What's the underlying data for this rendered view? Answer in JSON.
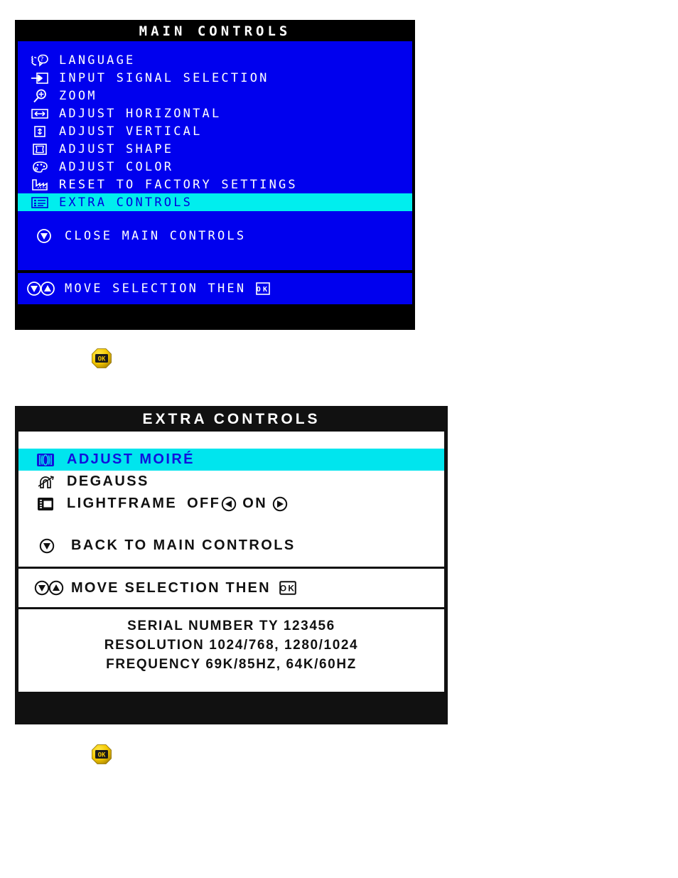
{
  "main_controls": {
    "title": "MAIN CONTROLS",
    "colors": {
      "background": "#0000ee",
      "header": "#000000",
      "text": "#ffffff",
      "highlight": "#00eeee",
      "highlight_text": "#0000dd"
    },
    "items": [
      {
        "icon": "language-head-question-icon",
        "label": "LANGUAGE",
        "selected": false
      },
      {
        "icon": "input-signal-arrow-icon",
        "label": "INPUT SIGNAL SELECTION",
        "selected": false
      },
      {
        "icon": "zoom-magnifier-icon",
        "label": "ZOOM",
        "selected": false
      },
      {
        "icon": "adjust-horizontal-icon",
        "label": "ADJUST HORIZONTAL",
        "selected": false
      },
      {
        "icon": "adjust-vertical-icon",
        "label": "ADJUST VERTICAL",
        "selected": false
      },
      {
        "icon": "adjust-shape-icon",
        "label": "ADJUST SHAPE",
        "selected": false
      },
      {
        "icon": "adjust-color-palette-icon",
        "label": "ADJUST COLOR",
        "selected": false
      },
      {
        "icon": "factory-reset-icon",
        "label": "RESET TO FACTORY SETTINGS",
        "selected": false
      },
      {
        "icon": "extra-controls-list-icon",
        "label": "EXTRA CONTROLS",
        "selected": true
      }
    ],
    "close_item": {
      "icon": "down-arrow-circle-icon",
      "label": "CLOSE MAIN CONTROLS"
    },
    "footer": {
      "icons": "down-up-arrow-circle-icons",
      "label": "MOVE SELECTION THEN",
      "ok_icon": "ok-key-icon"
    }
  },
  "ok_button_1": {
    "label": "OK",
    "name": "ok-button-icon"
  },
  "ok_button_2": {
    "label": "OK",
    "name": "ok-button-icon"
  },
  "extra_controls": {
    "title": "EXTRA CONTROLS",
    "colors": {
      "background": "#ffffff",
      "header": "#111111",
      "text": "#111111",
      "highlight": "#00e5ee",
      "highlight_text": "#1111dd"
    },
    "items": [
      {
        "icon": "adjust-moire-icon",
        "label": "ADJUST MOIRÉ",
        "selected": true
      },
      {
        "icon": "degauss-magnet-icon",
        "label": "DEGAUSS",
        "selected": false
      }
    ],
    "lightframe": {
      "icon": "lightframe-monitor-icon",
      "label": "LIGHTFRAME",
      "off_label": "OFF",
      "off_icon": "left-arrow-circle-icon",
      "on_label": "ON",
      "on_icon": "right-arrow-circle-icon"
    },
    "back_item": {
      "icon": "down-arrow-circle-icon",
      "label": "BACK TO MAIN CONTROLS"
    },
    "footer": {
      "icons": "down-up-arrow-circle-icons",
      "label": "MOVE SELECTION THEN",
      "ok_icon": "ok-key-icon"
    },
    "info": [
      "SERIAL NUMBER TY 123456",
      "RESOLUTION 1024/768, 1280/1024",
      "FREQUENCY 69K/85HZ, 64K/60HZ"
    ]
  }
}
